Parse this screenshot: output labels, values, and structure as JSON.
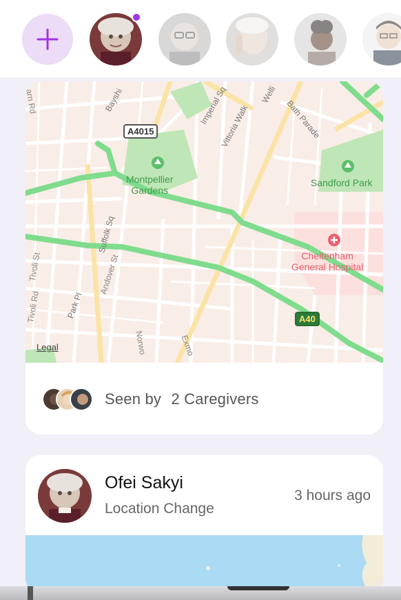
{
  "header": {
    "add_icon": "plus-icon",
    "avatars": [
      {
        "name": "avatar-ofei",
        "has_badge": true
      },
      {
        "name": "avatar-elderly-man"
      },
      {
        "name": "avatar-elderly-woman"
      },
      {
        "name": "avatar-woman-curly"
      },
      {
        "name": "avatar-young-man"
      }
    ],
    "accent": "#a136e6"
  },
  "map": {
    "labels": {
      "road_a4015": "A4015",
      "road_a40": "A40",
      "montpellier": "Montpellier\nGardens",
      "sandford": "Sandford Park",
      "hospital": "Cheltenham\nGeneral Hospital",
      "bayshill": "Bayshi",
      "imperial": "Imperial Sq",
      "vittoria": "Vittoria Walk",
      "wellington": "Welli",
      "bath": "Bath Parade",
      "suffolk": "Suffolk Sq",
      "andover": "Andover St",
      "park_pl": "Park Pl",
      "tivoli_rd": "Tivoli Rd",
      "tivoli_st": "Tivoli St",
      "norwood": "Norwo",
      "exmouth": "Exmo",
      "earn": "arn Rd",
      "legal": "Legal"
    }
  },
  "seen": {
    "label": "Seen by",
    "count_text": "2 Caregivers"
  },
  "post": {
    "name": "Ofei Sakyi",
    "event": "Location Change",
    "time": "3 hours ago"
  }
}
